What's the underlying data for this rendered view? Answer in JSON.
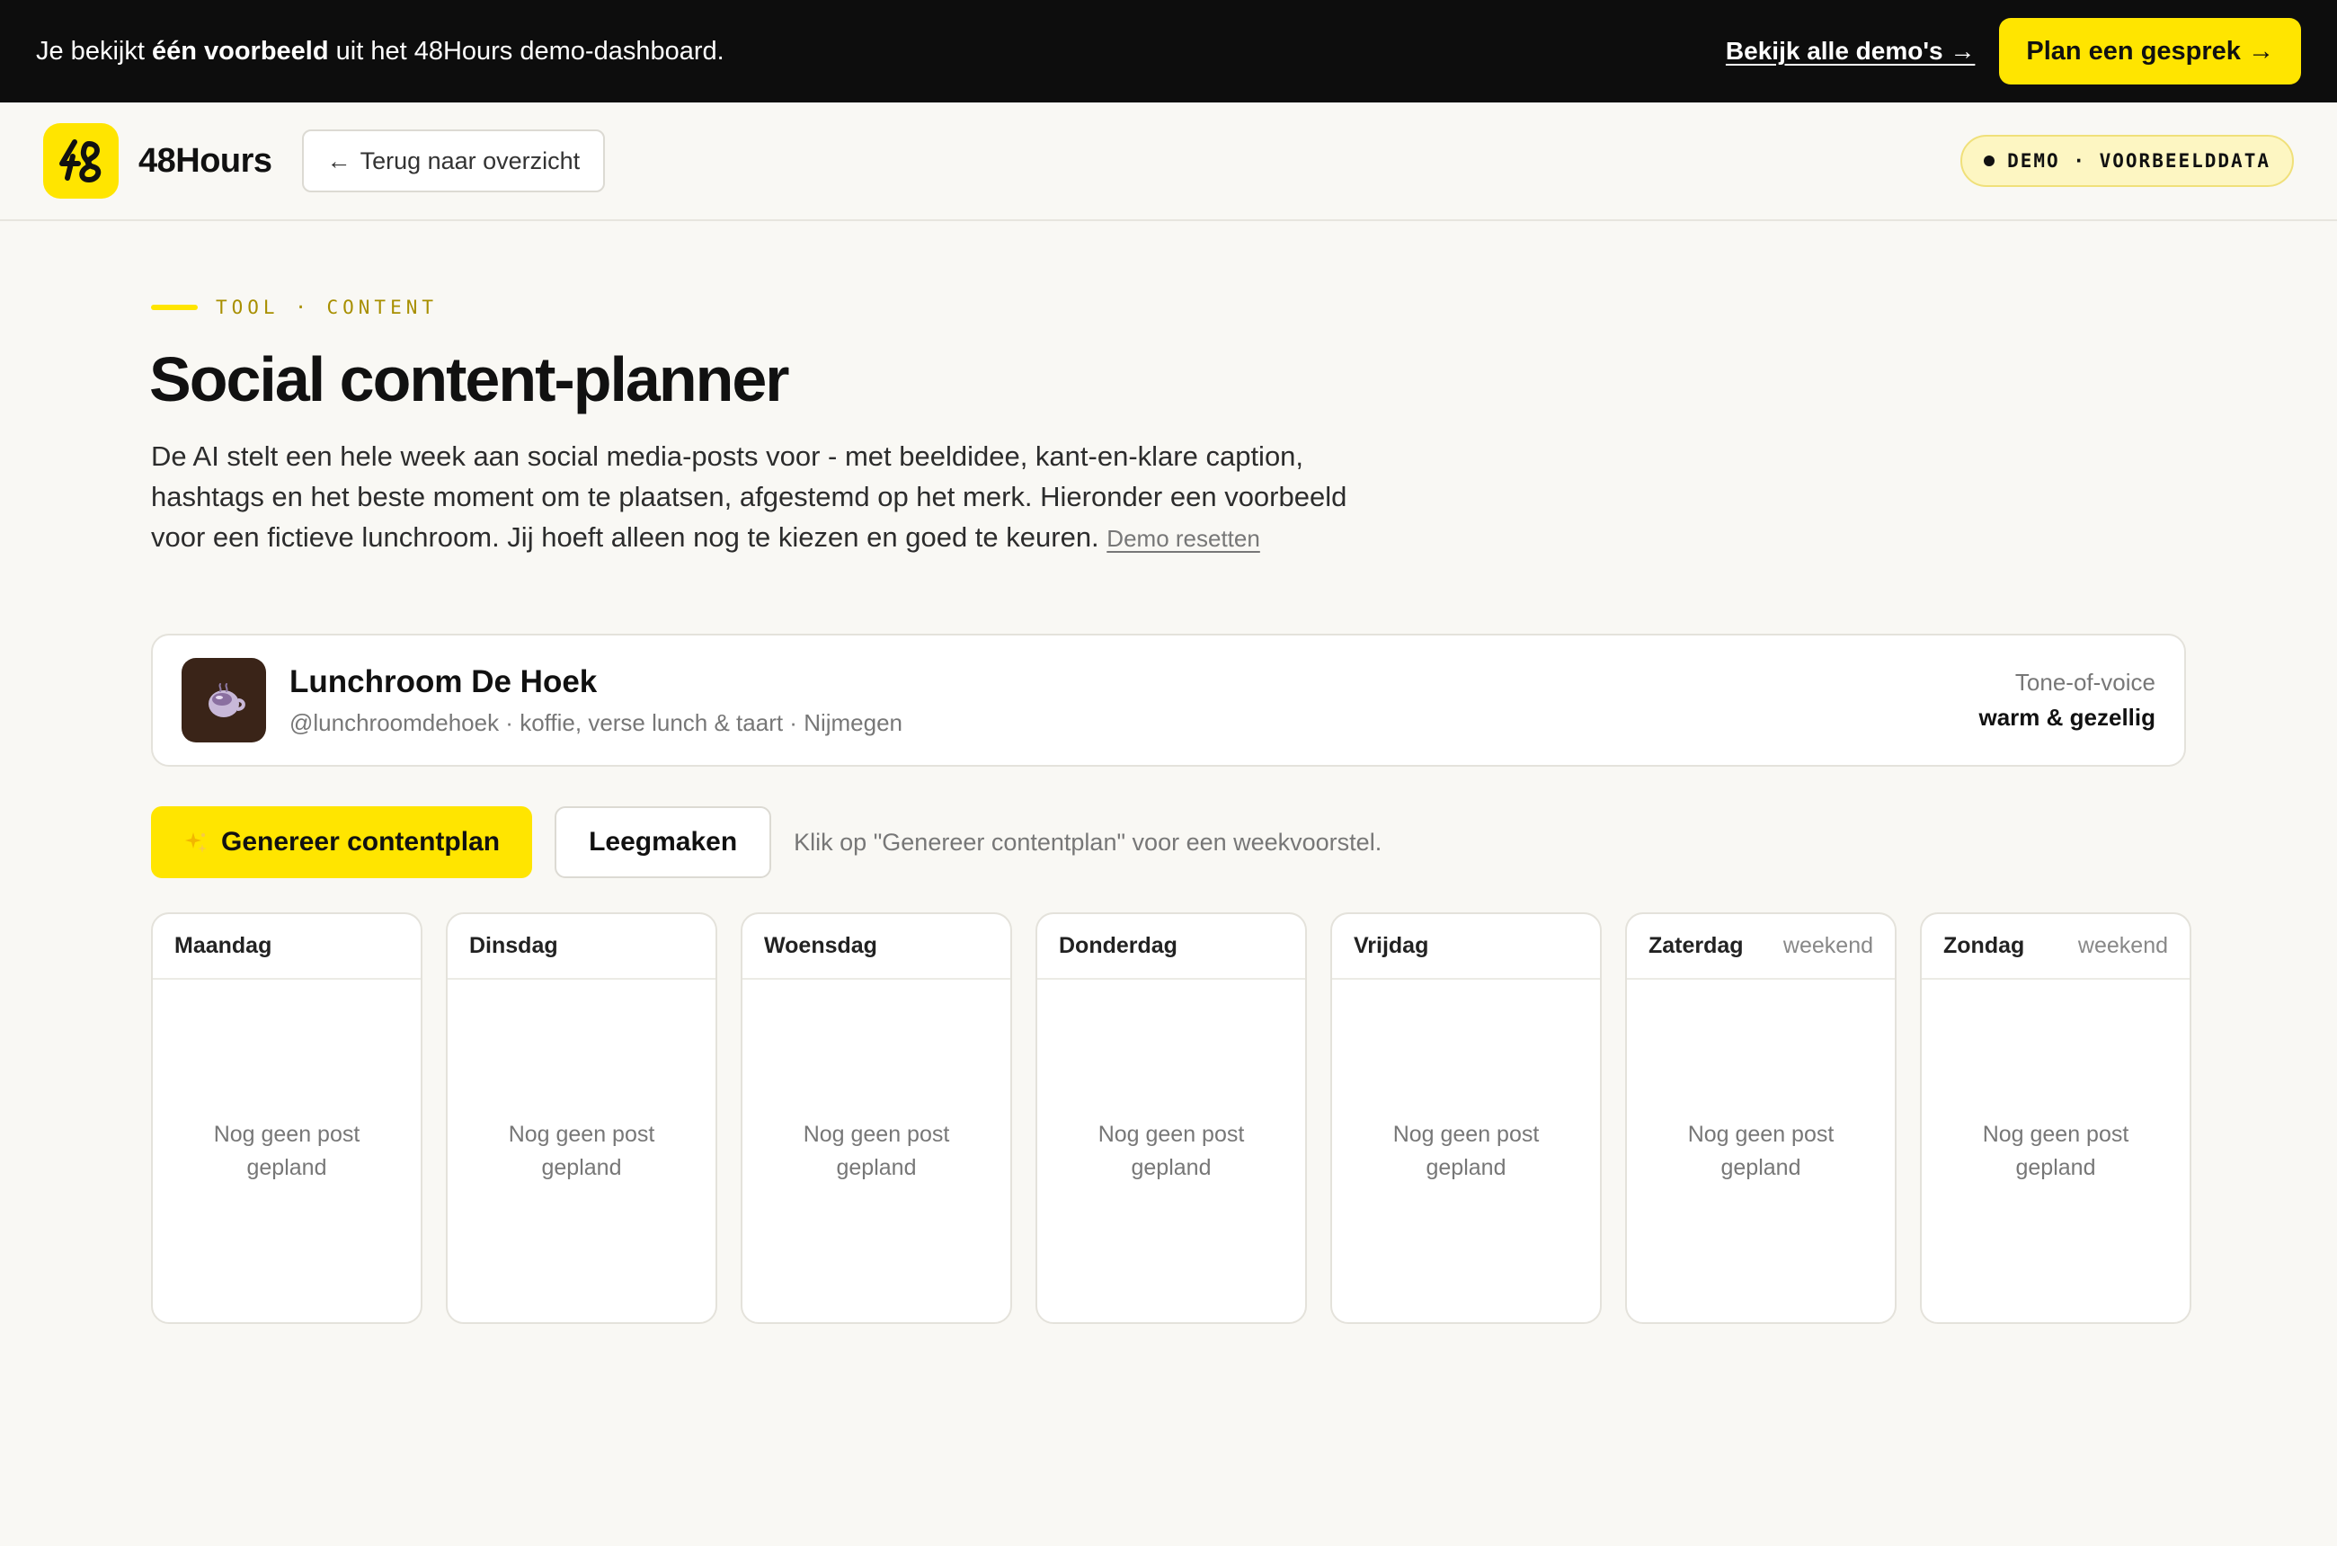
{
  "banner": {
    "text_prefix": "Je bekijkt ",
    "text_bold": "één voorbeeld",
    "text_suffix": " uit het 48Hours demo-dashboard.",
    "all_demos_link": "Bekijk alle demo's →",
    "cta_label": "Plan een gesprek →"
  },
  "header": {
    "brand": "48Hours",
    "back_label": "Terug naar overzicht",
    "back_arrow": "←",
    "demo_badge": "DEMO · VOORBEELDDATA"
  },
  "main": {
    "eyebrow": "TOOL · CONTENT",
    "title": "Social content-planner",
    "description": "De AI stelt een hele week aan social media-posts voor - met beeldidee, kant-en-klare caption, hashtags en het beste moment om te plaatsen, afgestemd op het merk. Hieronder een voorbeeld voor een fictieve lunchroom. Jij hoeft alleen nog te kiezen en goed te keuren.",
    "reset_link": "Demo resetten"
  },
  "brand_card": {
    "name": "Lunchroom De Hoek",
    "meta": "@lunchroomdehoek · koffie, verse lunch & taart · Nijmegen",
    "tone_label": "Tone-of-voice",
    "tone_value": "warm & gezellig",
    "avatar_icon": "coffee-cup-icon"
  },
  "actions": {
    "generate_label": "Genereer contentplan",
    "generate_icon": "sparkles-icon",
    "clear_label": "Leegmaken",
    "hint": "Klik op \"Genereer contentplan\" voor een weekvoorstel."
  },
  "week": {
    "empty_text": "Nog geen post gepland",
    "days": [
      {
        "name": "Maandag",
        "tag": ""
      },
      {
        "name": "Dinsdag",
        "tag": ""
      },
      {
        "name": "Woensdag",
        "tag": ""
      },
      {
        "name": "Donderdag",
        "tag": ""
      },
      {
        "name": "Vrijdag",
        "tag": ""
      },
      {
        "name": "Zaterdag",
        "tag": "weekend"
      },
      {
        "name": "Zondag",
        "tag": "weekend"
      }
    ]
  },
  "colors": {
    "accent": "#ffe500",
    "banner_bg": "#0d0d0d",
    "page_bg": "#f9f8f4",
    "eyebrow": "#a88f00"
  }
}
